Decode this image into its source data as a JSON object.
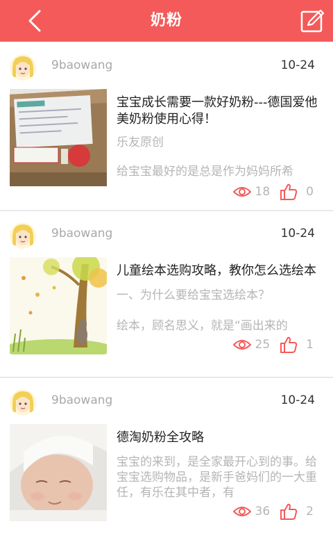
{
  "header": {
    "title": "奶粉",
    "back_icon": "chevron-left-icon",
    "edit_icon": "edit-note-icon",
    "bar_color": "#f45a5a"
  },
  "posts": [
    {
      "author": "9baowang",
      "date": "10-24",
      "title": "宝宝成长需要一款好奶粉---德国爱他美奶粉使用心得！",
      "summary1": "乐友原创",
      "summary2": "给宝宝最好的是总是作为妈妈所希",
      "views": "18",
      "likes": "0"
    },
    {
      "author": "9baowang",
      "date": "10-24",
      "title": "儿童绘本选购攻略，教你怎么选绘本",
      "summary1": "一、为什么要给宝宝选绘本？",
      "summary2": "绘本，顾名思义，就是“画出来的",
      "views": "25",
      "likes": "1"
    },
    {
      "author": "9baowang",
      "date": "10-24",
      "title": "德淘奶粉全攻略",
      "summary1": "宝宝的来到，是全家最开心到的事。给宝宝选购物品，是新手爸妈们的一大重任，有乐在其中者，有",
      "summary2": "",
      "views": "36",
      "likes": "2"
    }
  ]
}
